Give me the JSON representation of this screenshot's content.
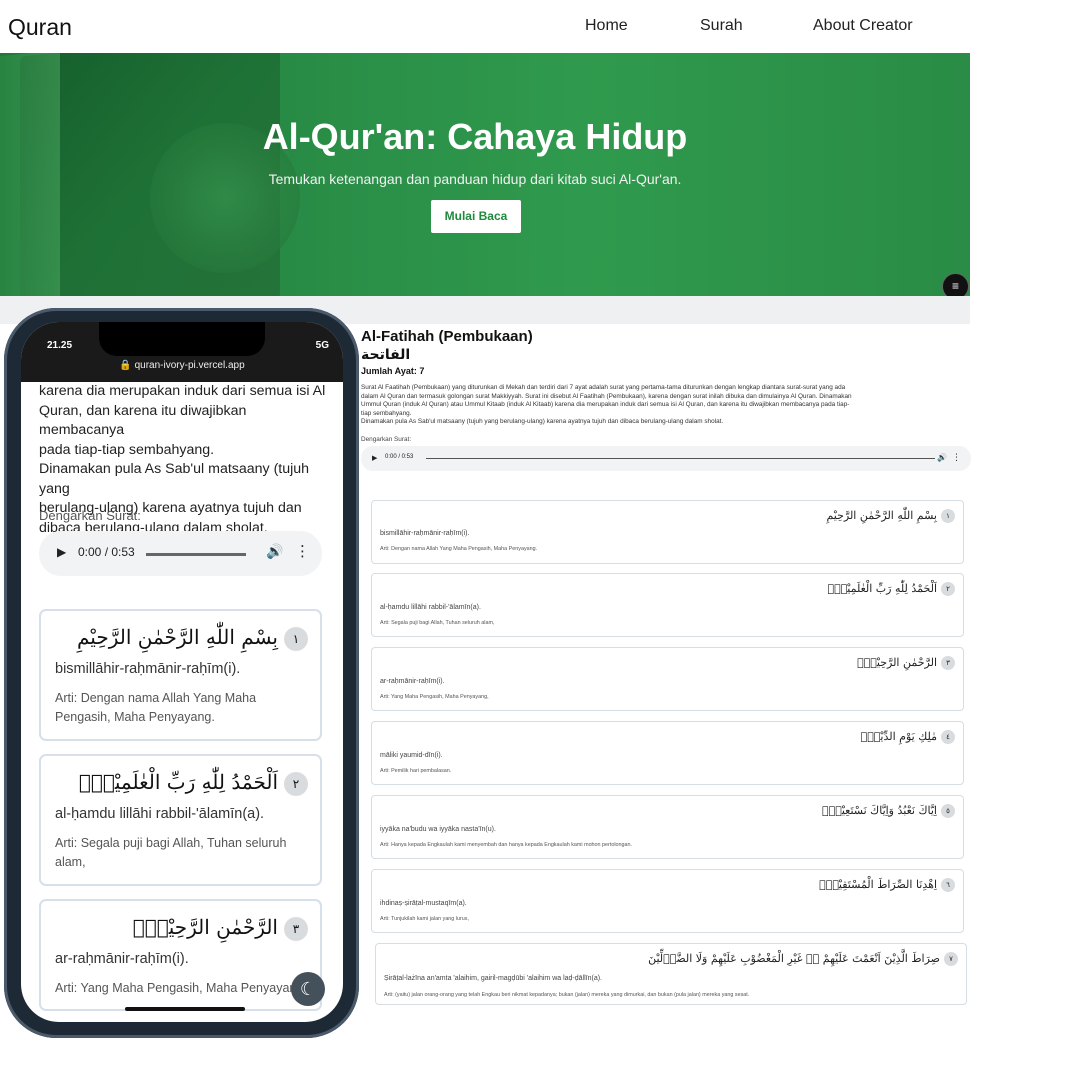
{
  "nav": {
    "brand": "Quran",
    "links": [
      "Home",
      "Surah",
      "About Creator"
    ]
  },
  "hero": {
    "title": "Al-Qur'an: Cahaya Hidup",
    "subtitle": "Temukan ketenangan dan panduan hidup dari kitab suci Al-Qur'an.",
    "cta": "Mulai Baca",
    "settings_icon": "≡"
  },
  "surah": {
    "name": "Al-Fatihah (Pembukaan)",
    "arabic": "الفاتحة",
    "ayat_count": "Jumlah Ayat: 7",
    "description_lines": [
      "Surat Al Faatihah (Pembukaan) yang diturunkan di Mekah dan terdiri dari 7 ayat adalah surat yang pertama-tama diturunkan dengan lengkap diantara surat-surat yang ada",
      "dalam Al Quran dan termasuk golongan surat Makkiyyah. Surat ini disebut Al Faatihah (Pembukaan), karena dengan surat inilah dibuka dan dimulainya Al Quran. Dinamakan",
      "Ummul Quran (induk Al Quran) atau Ummul Kitaab (induk Al Kitaab) karena dia merupakan induk dari semua isi Al Quran, dan karena itu diwajibkan membacanya pada tiap-",
      "tiap sembahyang.",
      "Dinamakan pula As Sab'ul matsaany (tujuh yang berulang-ulang) karena ayatnya tujuh dan dibaca berulang-ulang dalam sholat."
    ],
    "listen_label": "Dengarkan Surat:",
    "audio_time": "0:00 / 0:53"
  },
  "ayahs": [
    {
      "num": "١",
      "arabic": "بِسْمِ اللّٰهِ الرَّحْمٰنِ الرَّحِيْمِ",
      "translit": "bismillāhir-raḥmānir-raḥīm(i).",
      "arti": "Arti: Dengan nama Allah Yang Maha Pengasih, Maha Penyayang."
    },
    {
      "num": "٢",
      "arabic": "اَلْحَمْدُ لِلّٰهِ رَبِّ الْعٰلَمِيْنَۙ",
      "translit": "al-ḥamdu lillāhi rabbil-'ālamīn(a).",
      "arti": "Arti: Segala puji bagi Allah, Tuhan seluruh alam,"
    },
    {
      "num": "٣",
      "arabic": "الرَّحْمٰنِ الرَّحِيْمِۙ",
      "translit": "ar-raḥmānir-raḥīm(i).",
      "arti": "Arti: Yang Maha Pengasih, Maha Penyayang,"
    },
    {
      "num": "٤",
      "arabic": "مٰلِكِ يَوْمِ الدِّيْنِۗ",
      "translit": "māliki yaumid-dīn(i).",
      "arti": "Arti: Pemilik hari pembalasan."
    },
    {
      "num": "٥",
      "arabic": "اِيَّاكَ نَعْبُدُ وَاِيَّاكَ نَسْتَعِيْنُۗ",
      "translit": "iyyāka na'budu wa iyyāka nasta'īn(u).",
      "arti": "Arti: Hanya kepada Engkaulah kami menyembah dan hanya kepada Engkaulah kami mohon pertolongan."
    },
    {
      "num": "٦",
      "arabic": "اِهْدِنَا الصِّرَاطَ الْمُسْتَقِيْمَۙ",
      "translit": "ihdinaṣ-ṣirāṭal-mustaqīm(a).",
      "arti": "Arti: Tunjukilah kami jalan yang lurus,"
    },
    {
      "num": "٧",
      "arabic": "صِرَاطَ الَّذِيْنَ اَنْعَمْتَ عَلَيْهِمْ ەۙ غَيْرِ الْمَغْضُوْبِ عَلَيْهِمْ وَلَا الضَّاۤلِّيْنَ",
      "translit": "Ṣirāṭal-lażīna an'amta 'alaihim, gairil-magḍūbi 'alaihim wa laḍ-ḍāllīn(a).",
      "arti": "Arti: (yaitu) jalan orang-orang yang telah Engkau beri nikmat kepadanya; bukan (jalan) mereka yang dimurkai, dan bukan (pula jalan) mereka yang sesat."
    }
  ],
  "phone": {
    "status_time": "21.25",
    "status_signal": "5G",
    "url": "🔒 quran-ivory-pi.vercel.app",
    "text_lines": [
      "karena dia merupakan induk dari semua isi Al",
      "Quran, dan karena itu diwajibkan membacanya",
      "pada tiap-tiap sembahyang.",
      "Dinamakan pula As Sab'ul matsaany (tujuh yang",
      "berulang-ulang) karena ayatnya tujuh dan",
      "dibaca berulang-ulang dalam sholat."
    ],
    "listen_label": "Dengarkan Surat:",
    "audio_time": "0:00 / 0:53",
    "theme_icon": "☾"
  }
}
